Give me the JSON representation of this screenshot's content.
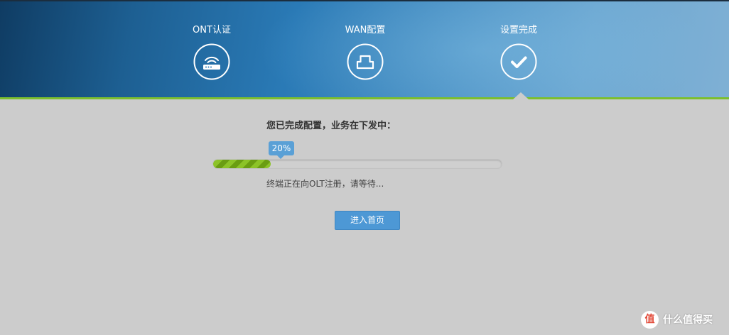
{
  "steps": [
    {
      "label": "ONT认证",
      "icon": "router-wifi-icon"
    },
    {
      "label": "WAN配置",
      "icon": "network-port-icon"
    },
    {
      "label": "设置完成",
      "icon": "checkmark-icon"
    }
  ],
  "active_step": "设置完成",
  "main": {
    "title": "您已完成配置，业务在下发中：",
    "progress": {
      "value": 20,
      "label": "20%"
    },
    "status": "终端正在向OLT注册，请等待...",
    "home_button": "进入首页"
  },
  "watermark": {
    "badge": "值",
    "text": "什么值得买"
  },
  "colors": {
    "accent": "#7cbf2e",
    "button": "#4d98d5",
    "progress_fill": "#7cb51c"
  }
}
